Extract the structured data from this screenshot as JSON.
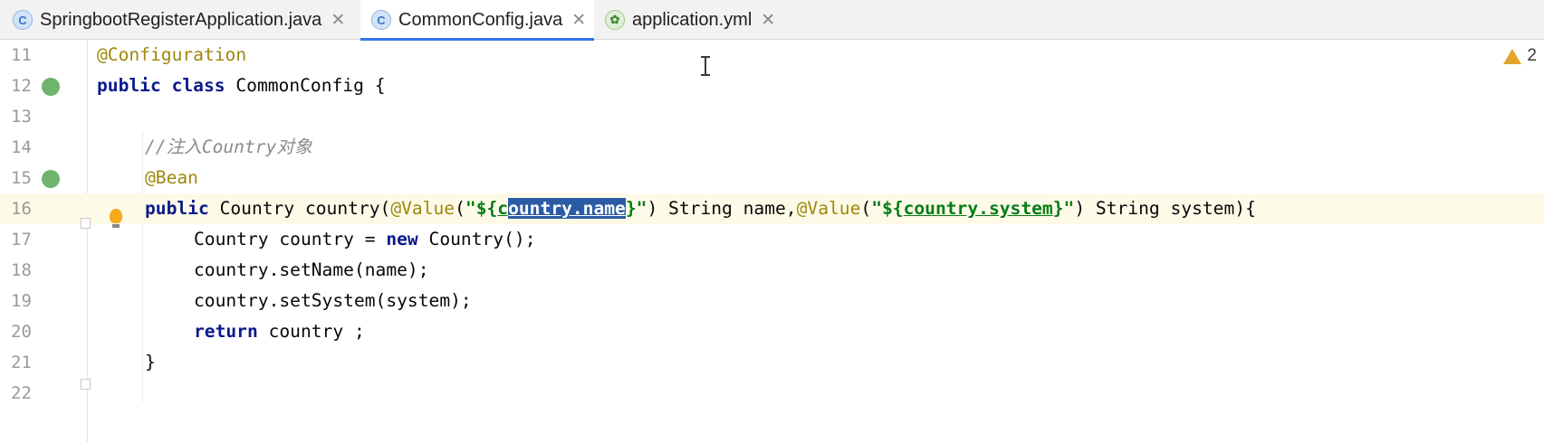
{
  "tabs": [
    {
      "label": "SpringbootRegisterApplication.java",
      "icon": "spring-boot-class-icon",
      "active": false
    },
    {
      "label": "CommonConfig.java",
      "icon": "class-icon",
      "active": true
    },
    {
      "label": "application.yml",
      "icon": "yaml-spring-icon",
      "active": false
    }
  ],
  "tab_icon_letter": "C",
  "close_glyph": "✕",
  "warnings": {
    "count": "2",
    "icon": "warning-icon"
  },
  "lines": [
    {
      "number": "11",
      "tokens": [
        "@Configuration"
      ]
    },
    {
      "number": "12",
      "tokens": [
        "public",
        " ",
        "class",
        " CommonConfig {"
      ]
    },
    {
      "number": "13",
      "tokens": []
    },
    {
      "number": "14",
      "tokens": [
        "//注入Country对象"
      ]
    },
    {
      "number": "15",
      "tokens": [
        "@Bean"
      ]
    },
    {
      "number": "16",
      "tokens": [
        "public",
        " Country country(",
        "@Value",
        "(",
        "\"${",
        "c",
        "ountry.name",
        "}\"",
        ") String name,",
        "@Value",
        "(",
        "\"${",
        "country.system",
        "}\"",
        ") String system){"
      ]
    },
    {
      "number": "17",
      "tokens": [
        "Country country = ",
        "new",
        " Country();"
      ]
    },
    {
      "number": "18",
      "tokens": [
        "country.setName(name);"
      ]
    },
    {
      "number": "19",
      "tokens": [
        "country.setSystem(system);"
      ]
    },
    {
      "number": "20",
      "tokens": [
        "return",
        " country ;"
      ]
    },
    {
      "number": "21",
      "tokens": [
        "}"
      ]
    },
    {
      "number": "22",
      "tokens": []
    }
  ],
  "colors": {
    "keyword": "#0a1a8c",
    "annotation": "#9e880d",
    "string": "#067d17",
    "comment": "#8c8c8c",
    "selection": "#2b5ba4",
    "current_line": "#fefae8",
    "tab_underline": "#3574f0"
  }
}
